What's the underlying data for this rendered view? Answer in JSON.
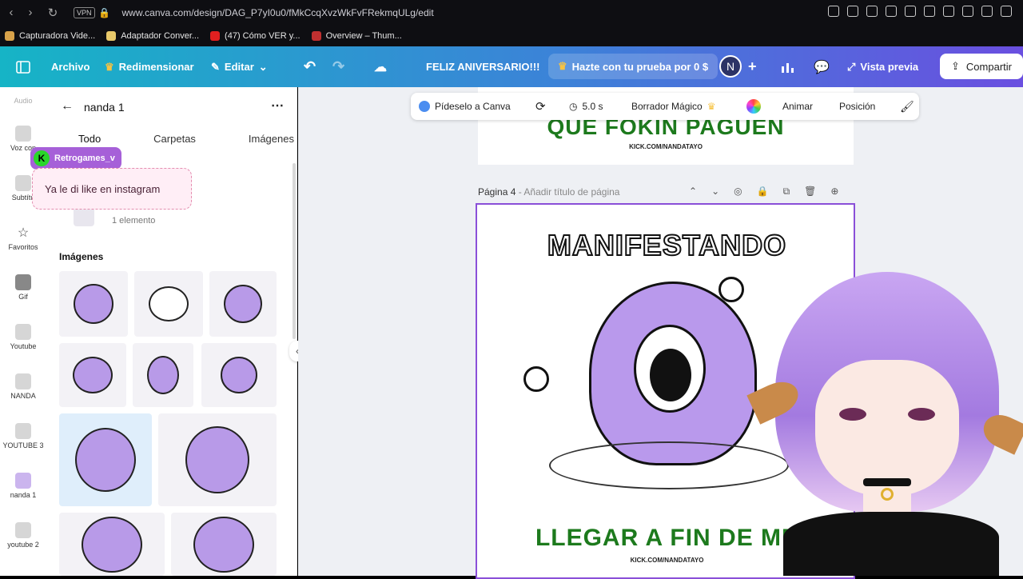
{
  "browser": {
    "vpn": "VPN",
    "url": "www.canva.com/design/DAG_P7yI0u0/fMkCcqXvzWkFvFRekmqULg/edit"
  },
  "bookmarks": [
    {
      "label": "Capturadora Vide...",
      "color": "#d8a24a"
    },
    {
      "label": "Adaptador Conver...",
      "color": "#e8c86a"
    },
    {
      "label": "(47) Cómo VER y...",
      "color": "#e02020"
    },
    {
      "label": "Overview – Thum...",
      "color": "#c03030"
    }
  ],
  "toolbar": {
    "archivo": "Archivo",
    "redimensionar": "Redimensionar",
    "editar": "Editar",
    "design_title": "FELIZ ANIVERSARIO!!!",
    "trial": "Hazte con tu prueba por 0 $",
    "avatar": "N",
    "preview": "Vista previa",
    "share": "Compartir"
  },
  "rail": [
    {
      "label": "Audio"
    },
    {
      "label": "Voz con"
    },
    {
      "label": "Subtítu"
    },
    {
      "label": "Favoritos"
    },
    {
      "label": "Gif"
    },
    {
      "label": "Youtube"
    },
    {
      "label": "NANDA"
    },
    {
      "label": "YOUTUBE 3"
    },
    {
      "label": "nanda 1"
    },
    {
      "label": "youtube 2"
    }
  ],
  "panel": {
    "title": "nanda 1",
    "tabs": [
      "Todo",
      "Carpetas",
      "Imágenes"
    ],
    "folder_count": "1 elemento",
    "images_heading": "Imágenes"
  },
  "chat": {
    "user": "Retrogames_v",
    "message": "Ya le di like en instagram"
  },
  "float_toolbar": {
    "ask": "Pídeselo a Canva",
    "duration": "5.0 s",
    "magic_eraser": "Borrador Mágico",
    "animate": "Animar",
    "position": "Posición"
  },
  "canvas": {
    "prev_page_text": "QUE FOKIN PAGUEN",
    "prev_page_kick": "KICK.COM/NANDATAYO",
    "page_label": "Página 4",
    "page_title_placeholder": "- Añadir título de página",
    "page_heading": "MANIFESTANDO",
    "page_footer": "LLEGAR A FIN DE ME",
    "page_kick": "KICK.COM/NANDATAYO"
  },
  "colors": {
    "accent_purple": "#8a4fd8",
    "canva_gradient_start": "#16b4c6",
    "canva_gradient_end": "#6a4fe0",
    "green_text": "#1d7a1d"
  }
}
